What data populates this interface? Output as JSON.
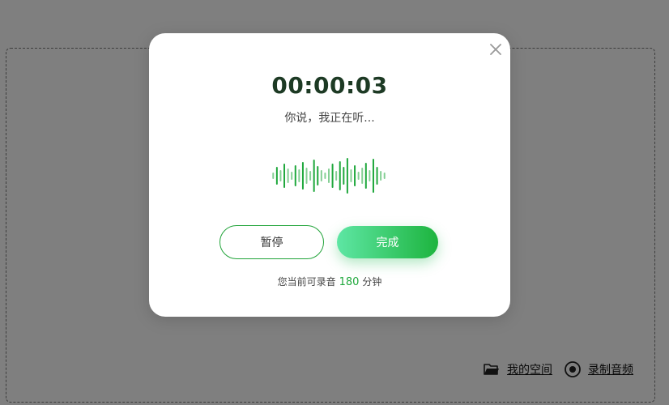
{
  "dialog": {
    "timer": "00:00:03",
    "status": "你说，我正在听...",
    "pause_label": "暂停",
    "done_label": "完成",
    "quota_prefix": "您当前可录音",
    "quota_value": "180",
    "quota_suffix": "分钟"
  },
  "bottom_links": {
    "my_space": "我的空间",
    "record_audio": "录制音频"
  },
  "colors": {
    "accent": "#1fa83c",
    "accent_light": "#5ee6a4",
    "timer_text": "#1d3a24",
    "overlay": "rgba(0,0,0,0.5)"
  },
  "icons": {
    "close": "close-icon",
    "waveform": "waveform-icon",
    "folder": "folder-icon",
    "record": "record-icon"
  }
}
